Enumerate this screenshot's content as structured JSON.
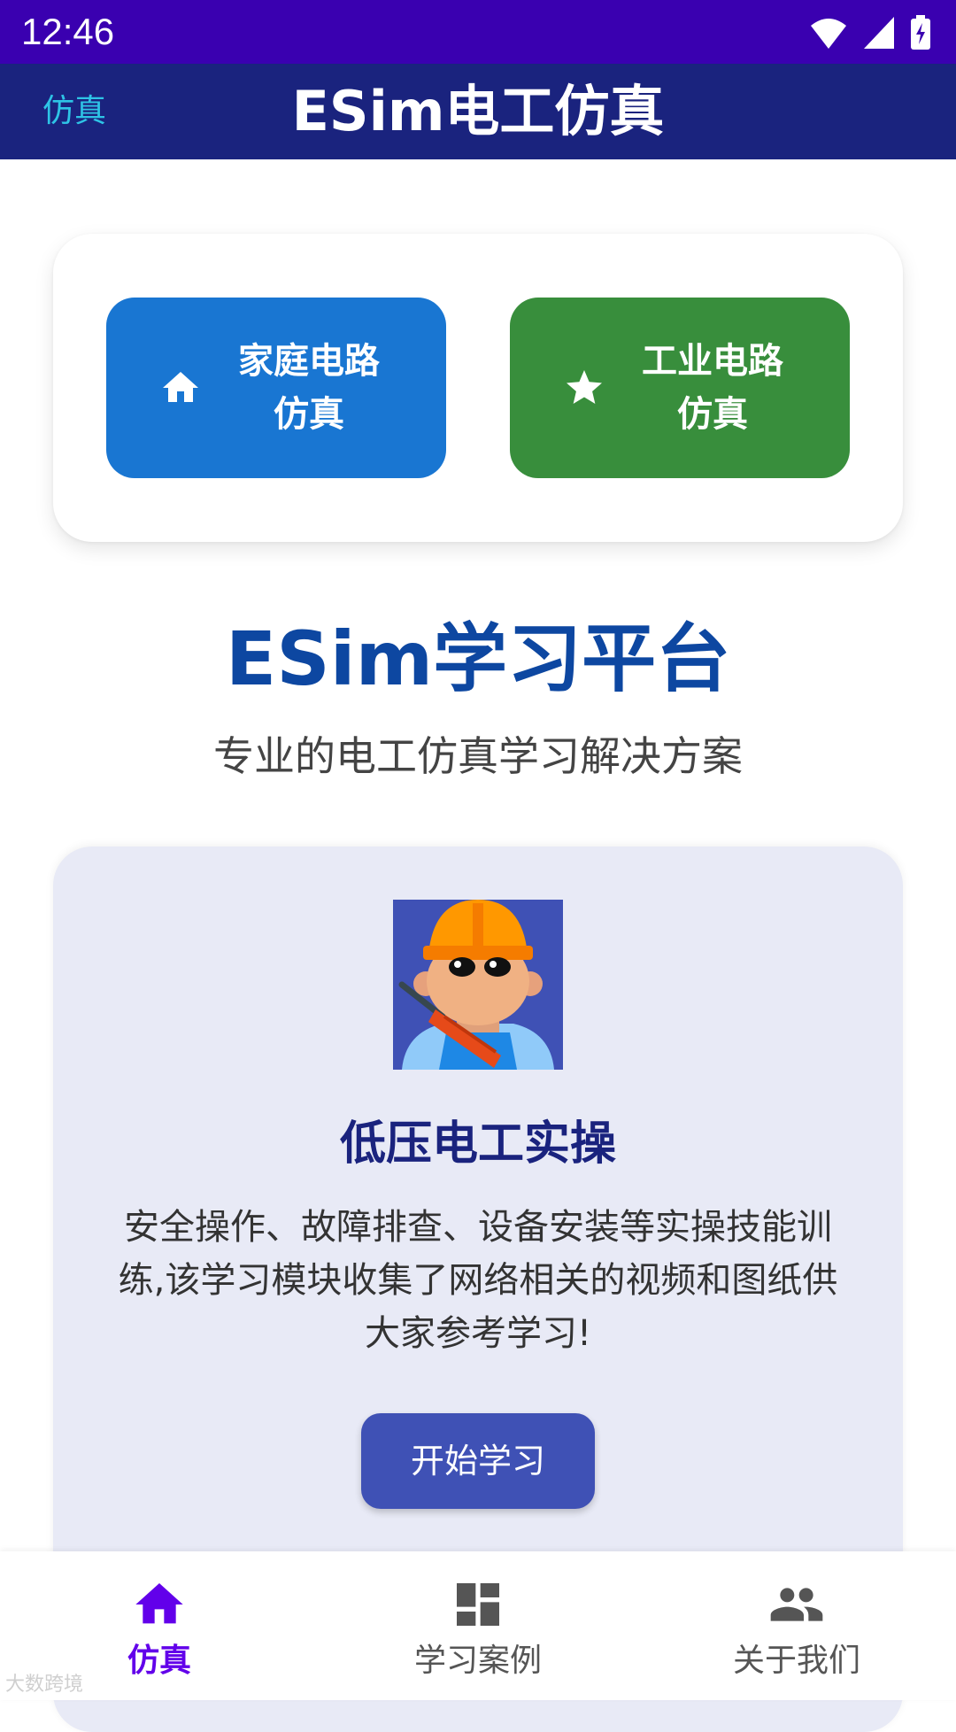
{
  "status_bar": {
    "time": "12:46"
  },
  "app_bar": {
    "back_label": "仿真",
    "title": "ESim电工仿真"
  },
  "modes": [
    {
      "label": "家庭电路仿真",
      "icon": "home-icon",
      "color": "#1976d2"
    },
    {
      "label": "工业电路仿真",
      "icon": "star-icon",
      "color": "#388e3c"
    }
  ],
  "platform": {
    "title": "ESim学习平台",
    "subtitle": "专业的电工仿真学习解决方案"
  },
  "course": {
    "title": "低压电工实操",
    "description": "安全操作、故障排查、设备安装等实操技能训练,该学习模块收集了网络相关的视频和图纸供大家参考学习!",
    "button_label": "开始学习"
  },
  "nav": [
    {
      "label": "仿真",
      "icon": "home-icon",
      "active": true
    },
    {
      "label": "学习案例",
      "icon": "dashboard-icon",
      "active": false
    },
    {
      "label": "关于我们",
      "icon": "people-icon",
      "active": false
    }
  ],
  "colors": {
    "status_bar": "#3a00b0",
    "app_bar": "#1a237e",
    "accent": "#6200ea",
    "course_card": "#e8eaf6",
    "start_button": "#3f51b5"
  },
  "watermark": "大数跨境"
}
